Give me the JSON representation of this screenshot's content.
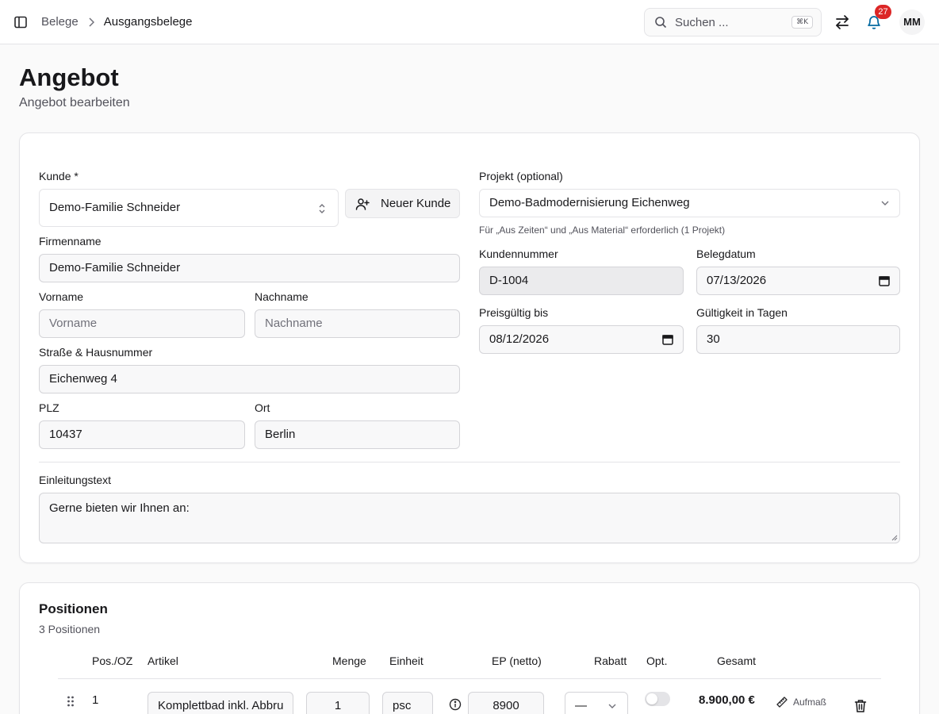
{
  "breadcrumb": [
    "Belege",
    "Ausgangsbelege"
  ],
  "search": {
    "placeholder": "Suchen ...",
    "shortcut": "⌘K"
  },
  "notifications": {
    "count": "27"
  },
  "user": {
    "initials": "MM"
  },
  "page": {
    "title": "Angebot",
    "subtitle": "Angebot bearbeiten"
  },
  "form": {
    "kunde": {
      "label": "Kunde *",
      "value": "Demo-Familie Schneider"
    },
    "new_customer_label": "Neuer Kunde",
    "firmenname": {
      "label": "Firmenname",
      "value": "Demo-Familie Schneider"
    },
    "vorname": {
      "label": "Vorname",
      "placeholder": "Vorname"
    },
    "nachname": {
      "label": "Nachname",
      "placeholder": "Nachname"
    },
    "strasse": {
      "label": "Straße & Hausnummer",
      "value": "Eichenweg 4"
    },
    "plz": {
      "label": "PLZ",
      "value": "10437"
    },
    "ort": {
      "label": "Ort",
      "value": "Berlin"
    },
    "projekt": {
      "label": "Projekt (optional)",
      "value": "Demo-Badmodernisierung Eichenweg",
      "help": "Für „Aus Zeiten“ und „Aus Material“ erforderlich (1 Projekt)"
    },
    "kundennummer": {
      "label": "Kundennummer",
      "value": "D-1004"
    },
    "belegdatum": {
      "label": "Belegdatum",
      "value": "07/13/2026"
    },
    "preisgueltig": {
      "label": "Preisgültig bis",
      "value": "08/12/2026"
    },
    "gueltigkeit": {
      "label": "Gültigkeit in Tagen",
      "value": "30"
    },
    "einleitung": {
      "label": "Einleitungstext",
      "value": "Gerne bieten wir Ihnen an:"
    }
  },
  "positionen": {
    "title": "Positionen",
    "count": "3 Positionen",
    "headers": [
      "Pos./OZ",
      "Artikel",
      "Menge",
      "Einheit",
      "EP (netto)",
      "Rabatt",
      "Opt.",
      "Gesamt"
    ],
    "rows": [
      {
        "pos": "1",
        "artikel": "Komplettbad inkl. Abbru",
        "menge": "1",
        "einheit": "psc",
        "ep": "8900",
        "rabatt": "—",
        "optional": false,
        "gesamt": "8.900,00 €",
        "aufmass": "Aufmaß"
      }
    ]
  }
}
